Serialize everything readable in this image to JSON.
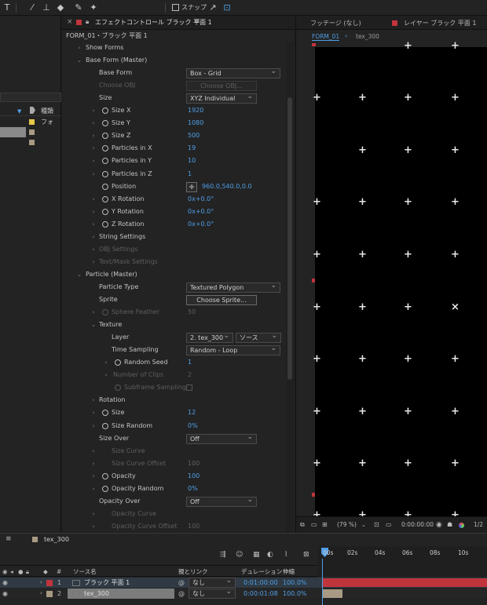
{
  "toolbar": {
    "snap_label": "スナップ",
    "icons": [
      "text-tool-icon",
      "pen-brush-icon",
      "stamp-tool-icon",
      "eraser-tool-icon",
      "roto-brush-icon",
      "puppet-pin-icon"
    ]
  },
  "left_panel": {
    "column_header": "種類",
    "rows": [
      "フォ",
      "",
      ""
    ]
  },
  "effect_controls": {
    "tab_label": "エフェクトコントロール ブラック 平面 1",
    "subtitle": "FORM_01・ブラック 平面 1",
    "rows": [
      {
        "label": "Show Forms",
        "type": "group"
      },
      {
        "label": "Base Form (Master)",
        "type": "group-open"
      },
      {
        "label": "Base Form",
        "type": "dropdown",
        "value": "Box - Grid"
      },
      {
        "label": "Choose OBJ",
        "type": "button",
        "value": "Choose OBJ...",
        "dim": true
      },
      {
        "label": "Size",
        "type": "dropdown",
        "value": "XYZ Individual"
      },
      {
        "label": "Size X",
        "type": "value",
        "value": "1920"
      },
      {
        "label": "Size Y",
        "type": "value",
        "value": "1080"
      },
      {
        "label": "Size Z",
        "type": "value",
        "value": "500"
      },
      {
        "label": "Particles in X",
        "type": "value",
        "value": "19"
      },
      {
        "label": "Particles in Y",
        "type": "value",
        "value": "10"
      },
      {
        "label": "Particles in Z",
        "type": "value",
        "value": "1"
      },
      {
        "label": "Position",
        "type": "position",
        "value": "960.0,540.0,0.0"
      },
      {
        "label": "X Rotation",
        "type": "value",
        "value": "0x+0.0°"
      },
      {
        "label": "Y Rotation",
        "type": "value",
        "value": "0x+0.0°"
      },
      {
        "label": "Z Rotation",
        "type": "value",
        "value": "0x+0.0°"
      },
      {
        "label": "String Settings",
        "type": "subgroup"
      },
      {
        "label": "OBJ Settings",
        "type": "subgroup",
        "dim": true
      },
      {
        "label": "Text/Mask Settings",
        "type": "subgroup",
        "dim": true
      },
      {
        "label": "Particle (Master)",
        "type": "group-open"
      },
      {
        "label": "Particle Type",
        "type": "dropdown",
        "value": "Textured Polygon"
      },
      {
        "label": "Sprite",
        "type": "button",
        "value": "Choose Sprite..."
      },
      {
        "label": "Sphere Feather",
        "type": "value",
        "value": "50",
        "dim": true
      },
      {
        "label": "Texture",
        "type": "subgroup-open"
      },
      {
        "label": "Layer",
        "type": "layer",
        "value": "2. tex_300",
        "value2": "ソース"
      },
      {
        "label": "Time Sampling",
        "type": "dropdown",
        "value": "Random - Loop"
      },
      {
        "label": "Random Seed",
        "type": "value",
        "value": "1"
      },
      {
        "label": "Number of Clips",
        "type": "value",
        "value": "2",
        "dim": true
      },
      {
        "label": "Subframe Sampling",
        "type": "checkbox",
        "dim": true
      },
      {
        "label": "Rotation",
        "type": "subgroup"
      },
      {
        "label": "Size",
        "type": "value",
        "value": "12"
      },
      {
        "label": "Size Random",
        "type": "value",
        "value": "0%"
      },
      {
        "label": "Size Over",
        "type": "dropdown",
        "value": "Off"
      },
      {
        "label": "Size Curve",
        "type": "subgroup",
        "dim": true
      },
      {
        "label": "Size Curve Offset",
        "type": "value",
        "value": "100",
        "dim": true
      },
      {
        "label": "Opacity",
        "type": "value",
        "value": "100"
      },
      {
        "label": "Opacity Random",
        "type": "value",
        "value": "0%"
      },
      {
        "label": "Opacity Over",
        "type": "dropdown",
        "value": "Off"
      },
      {
        "label": "Opacity Curve",
        "type": "subgroup",
        "dim": true
      },
      {
        "label": "Opacity Curve Offset",
        "type": "value",
        "value": "100",
        "dim": true
      }
    ]
  },
  "composition": {
    "tab_footage": "フッテージ (なし)",
    "tab_layer": "レイヤー ブラック 平面 1",
    "sub_tab_active": "FORM_01",
    "sub_tab_other": "tex_300",
    "zoom": "(79 %)",
    "timecode": "0:00:00:00",
    "resolution": "1/2"
  },
  "timeline": {
    "tab_label": "tex_300",
    "header_source": "ソース名",
    "header_parent": "親とリンク",
    "header_duration": "デュレーション",
    "header_stretch": "伸縮",
    "ruler": [
      "00s",
      "02s",
      "04s",
      "06s",
      "08s",
      "10s"
    ],
    "layers": [
      {
        "num": "1",
        "name": "ブラック 平面 1",
        "parent": "なし",
        "duration": "0:01:00:00",
        "stretch": "100.0%",
        "color": "#c0343c"
      },
      {
        "num": "2",
        "name": "tex_300",
        "parent": "なし",
        "duration": "0:00:01:08",
        "stretch": "100.0%",
        "color": "#a89a83"
      }
    ]
  },
  "colors": {
    "accent": "#4f9fe8",
    "layer1": "#c0343c",
    "layer2": "#a89a83"
  }
}
